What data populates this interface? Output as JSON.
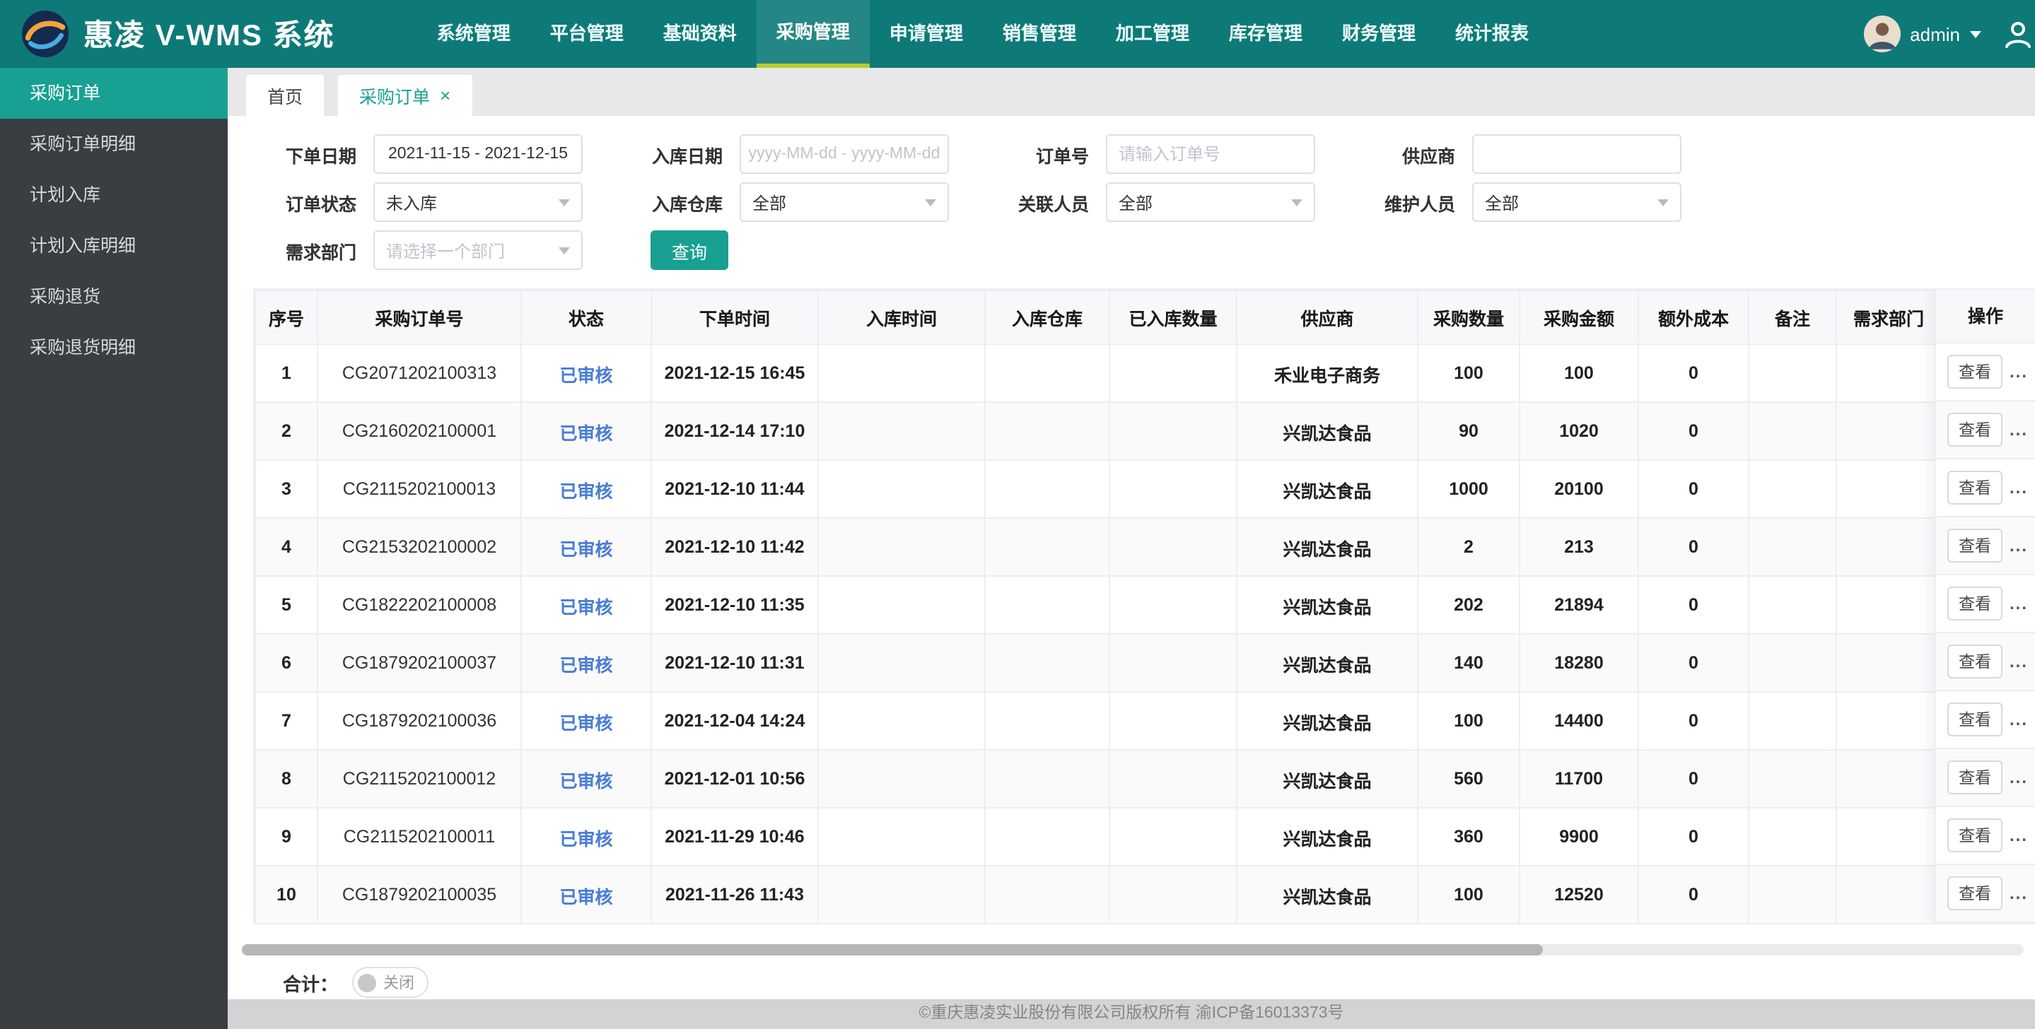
{
  "colors": {
    "navbar": "#0d7a78",
    "accent": "#18a092",
    "active_underline": "#b6cb2f",
    "status_link": "#4a7dd6"
  },
  "navbar": {
    "brand": "惠凌 V-WMS 系统",
    "menu": [
      "系统管理",
      "平台管理",
      "基础资料",
      "采购管理",
      "申请管理",
      "销售管理",
      "加工管理",
      "库存管理",
      "财务管理",
      "统计报表"
    ],
    "active": "采购管理",
    "user": {
      "name": "admin"
    }
  },
  "sidebar": {
    "items": [
      "采购订单",
      "采购订单明细",
      "计划入库",
      "计划入库明细",
      "采购退货",
      "采购退货明细"
    ],
    "active": "采购订单"
  },
  "tabs": {
    "items": [
      {
        "label": "首页"
      },
      {
        "label": "采购订单"
      }
    ],
    "active": "采购订单",
    "close_icon": "×"
  },
  "filters": {
    "order_date": {
      "label": "下单日期",
      "value": "2021-11-15 - 2021-12-15"
    },
    "inbound_date": {
      "label": "入库日期",
      "placeholder": "yyyy-MM-dd - yyyy-MM-dd"
    },
    "order_no": {
      "label": "订单号",
      "placeholder": "请输入订单号"
    },
    "supplier": {
      "label": "供应商",
      "value": ""
    },
    "order_status": {
      "label": "订单状态",
      "value": "未入库"
    },
    "warehouse": {
      "label": "入库仓库",
      "value": "全部"
    },
    "related_person": {
      "label": "关联人员",
      "value": "全部"
    },
    "maintainer": {
      "label": "维护人员",
      "value": "全部"
    },
    "department": {
      "label": "需求部门",
      "placeholder": "请选择一个部门"
    },
    "search_label": "查询"
  },
  "table": {
    "columns": [
      "序号",
      "采购订单号",
      "状态",
      "下单时间",
      "入库时间",
      "入库仓库",
      "已入库数量",
      "供应商",
      "采购数量",
      "采购金额",
      "额外成本",
      "备注",
      "需求部门",
      "操作"
    ],
    "rows": [
      [
        "1",
        "CG2071202100313",
        "已审核",
        "2021-12-15 16:45",
        "",
        "",
        "",
        "禾业电子商务",
        "100",
        "100",
        "0",
        "",
        ""
      ],
      [
        "2",
        "CG2160202100001",
        "已审核",
        "2021-12-14 17:10",
        "",
        "",
        "",
        "兴凯达食品",
        "90",
        "1020",
        "0",
        "",
        ""
      ],
      [
        "3",
        "CG2115202100013",
        "已审核",
        "2021-12-10 11:44",
        "",
        "",
        "",
        "兴凯达食品",
        "1000",
        "20100",
        "0",
        "",
        ""
      ],
      [
        "4",
        "CG2153202100002",
        "已审核",
        "2021-12-10 11:42",
        "",
        "",
        "",
        "兴凯达食品",
        "2",
        "213",
        "0",
        "",
        ""
      ],
      [
        "5",
        "CG1822202100008",
        "已审核",
        "2021-12-10 11:35",
        "",
        "",
        "",
        "兴凯达食品",
        "202",
        "21894",
        "0",
        "",
        ""
      ],
      [
        "6",
        "CG1879202100037",
        "已审核",
        "2021-12-10 11:31",
        "",
        "",
        "",
        "兴凯达食品",
        "140",
        "18280",
        "0",
        "",
        ""
      ],
      [
        "7",
        "CG1879202100036",
        "已审核",
        "2021-12-04 14:24",
        "",
        "",
        "",
        "兴凯达食品",
        "100",
        "14400",
        "0",
        "",
        ""
      ],
      [
        "8",
        "CG2115202100012",
        "已审核",
        "2021-12-01 10:56",
        "",
        "",
        "",
        "兴凯达食品",
        "560",
        "11700",
        "0",
        "",
        ""
      ],
      [
        "9",
        "CG2115202100011",
        "已审核",
        "2021-11-29 10:46",
        "",
        "",
        "",
        "兴凯达食品",
        "360",
        "9900",
        "0",
        "",
        ""
      ],
      [
        "10",
        "CG1879202100035",
        "已审核",
        "2021-11-26 11:43",
        "",
        "",
        "",
        "兴凯达食品",
        "100",
        "12520",
        "0",
        "",
        ""
      ]
    ],
    "view_label": "查看",
    "more_label": "..."
  },
  "summary": {
    "label": "合计：",
    "toggle_label": "关闭"
  },
  "footer": {
    "copyright": "©重庆惠凌实业股份有限公司版权所有 渝ICP备16013373号"
  }
}
